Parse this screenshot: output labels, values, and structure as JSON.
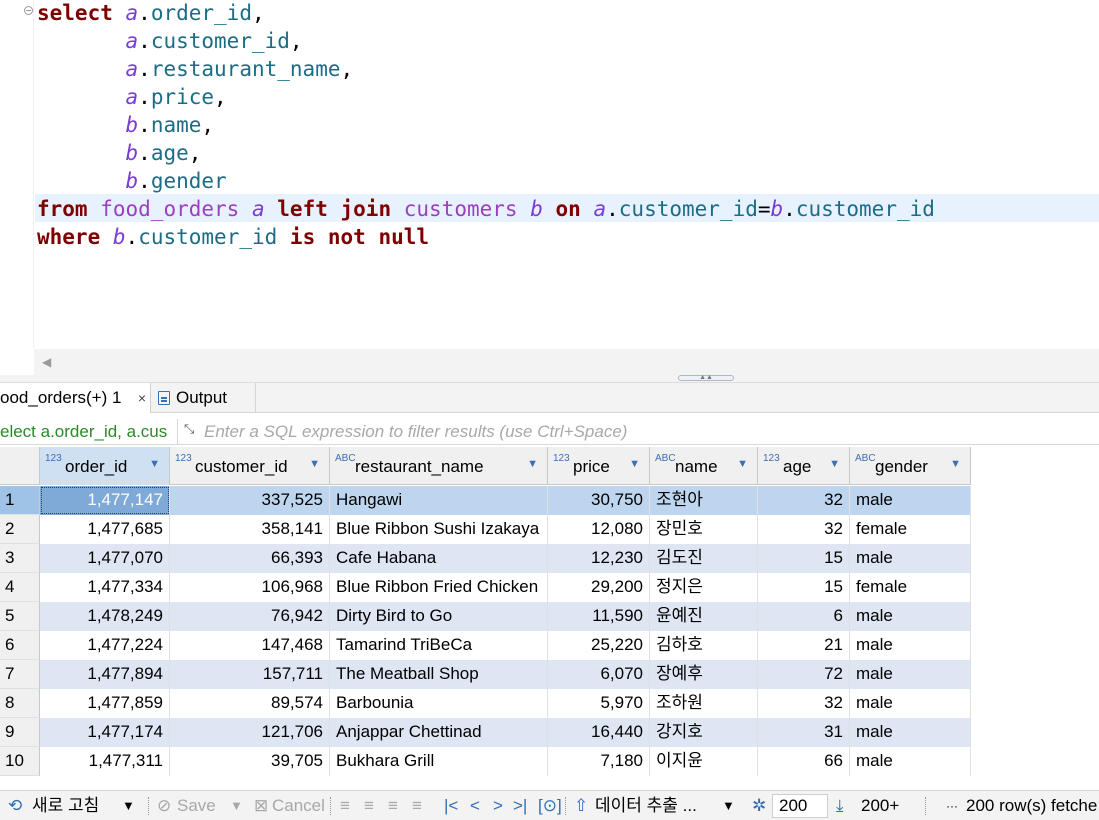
{
  "editor": {
    "lines": [
      [
        {
          "t": "select",
          "c": "kw"
        },
        {
          "t": " "
        },
        {
          "t": "a",
          "c": "al"
        },
        {
          "t": "."
        },
        {
          "t": "order_id",
          "c": "col"
        },
        {
          "t": ","
        }
      ],
      [
        {
          "t": "       "
        },
        {
          "t": "a",
          "c": "al"
        },
        {
          "t": "."
        },
        {
          "t": "customer_id",
          "c": "col"
        },
        {
          "t": ","
        }
      ],
      [
        {
          "t": "       "
        },
        {
          "t": "a",
          "c": "al"
        },
        {
          "t": "."
        },
        {
          "t": "restaurant_name",
          "c": "col"
        },
        {
          "t": ","
        }
      ],
      [
        {
          "t": "       "
        },
        {
          "t": "a",
          "c": "al"
        },
        {
          "t": "."
        },
        {
          "t": "price",
          "c": "col"
        },
        {
          "t": ","
        }
      ],
      [
        {
          "t": "       "
        },
        {
          "t": "b",
          "c": "al"
        },
        {
          "t": "."
        },
        {
          "t": "name",
          "c": "col"
        },
        {
          "t": ","
        }
      ],
      [
        {
          "t": "       "
        },
        {
          "t": "b",
          "c": "al"
        },
        {
          "t": "."
        },
        {
          "t": "age",
          "c": "col"
        },
        {
          "t": ","
        }
      ],
      [
        {
          "t": "       "
        },
        {
          "t": "b",
          "c": "al"
        },
        {
          "t": "."
        },
        {
          "t": "gender",
          "c": "col"
        }
      ],
      [
        {
          "t": "from",
          "c": "kw"
        },
        {
          "t": " "
        },
        {
          "t": "food_orders",
          "c": "tbl"
        },
        {
          "t": " "
        },
        {
          "t": "a",
          "c": "al"
        },
        {
          "t": " "
        },
        {
          "t": "left",
          "c": "kw"
        },
        {
          "t": " "
        },
        {
          "t": "join",
          "c": "kw"
        },
        {
          "t": " "
        },
        {
          "t": "customers",
          "c": "tbl"
        },
        {
          "t": " "
        },
        {
          "t": "b",
          "c": "al"
        },
        {
          "t": " "
        },
        {
          "t": "on",
          "c": "kw"
        },
        {
          "t": " "
        },
        {
          "t": "a",
          "c": "al"
        },
        {
          "t": "."
        },
        {
          "t": "customer_id",
          "c": "col"
        },
        {
          "t": "="
        },
        {
          "t": "b",
          "c": "al"
        },
        {
          "t": "."
        },
        {
          "t": "customer_id",
          "c": "col"
        }
      ],
      [
        {
          "t": "where",
          "c": "kw"
        },
        {
          "t": " "
        },
        {
          "t": "b",
          "c": "al"
        },
        {
          "t": "."
        },
        {
          "t": "customer_id",
          "c": "col"
        },
        {
          "t": " "
        },
        {
          "t": "is",
          "c": "kw"
        },
        {
          "t": " "
        },
        {
          "t": "not",
          "c": "kw"
        },
        {
          "t": " "
        },
        {
          "t": "null",
          "c": "kw"
        }
      ]
    ]
  },
  "tabs": {
    "results_label": "ood_orders(+) 1",
    "close_glyph": "×",
    "output_label": "Output"
  },
  "filter": {
    "query_text": "elect a.order_id, a.cus",
    "placeholder": "Enter a SQL expression to filter results (use Ctrl+Space)"
  },
  "grid": {
    "columns": [
      {
        "name": "order_id",
        "type": "123"
      },
      {
        "name": "customer_id",
        "type": "123"
      },
      {
        "name": "restaurant_name",
        "type": "ABC"
      },
      {
        "name": "price",
        "type": "123"
      },
      {
        "name": "name",
        "type": "ABC"
      },
      {
        "name": "age",
        "type": "123"
      },
      {
        "name": "gender",
        "type": "ABC"
      }
    ],
    "rows": [
      {
        "n": "1",
        "cells": [
          "1,477,147",
          "337,525",
          "Hangawi",
          "30,750",
          "조현아",
          "32",
          "male"
        ]
      },
      {
        "n": "2",
        "cells": [
          "1,477,685",
          "358,141",
          "Blue Ribbon Sushi Izakaya",
          "12,080",
          "장민호",
          "32",
          "female"
        ]
      },
      {
        "n": "3",
        "cells": [
          "1,477,070",
          "66,393",
          "Cafe Habana",
          "12,230",
          "김도진",
          "15",
          "male"
        ]
      },
      {
        "n": "4",
        "cells": [
          "1,477,334",
          "106,968",
          "Blue Ribbon Fried Chicken",
          "29,200",
          "정지은",
          "15",
          "female"
        ]
      },
      {
        "n": "5",
        "cells": [
          "1,478,249",
          "76,942",
          "Dirty Bird to Go",
          "11,590",
          "윤예진",
          "6",
          "male"
        ]
      },
      {
        "n": "6",
        "cells": [
          "1,477,224",
          "147,468",
          "Tamarind TriBeCa",
          "25,220",
          "김하호",
          "21",
          "male"
        ]
      },
      {
        "n": "7",
        "cells": [
          "1,477,894",
          "157,711",
          "The Meatball Shop",
          "6,070",
          "장예후",
          "72",
          "male"
        ]
      },
      {
        "n": "8",
        "cells": [
          "1,477,859",
          "89,574",
          "Barbounia",
          "5,970",
          "조하원",
          "32",
          "male"
        ]
      },
      {
        "n": "9",
        "cells": [
          "1,477,174",
          "121,706",
          "Anjappar Chettinad",
          "16,440",
          "강지호",
          "31",
          "male"
        ]
      },
      {
        "n": "10",
        "cells": [
          "1,477,311",
          "39,705",
          "Bukhara Grill",
          "7,180",
          "이지윤",
          "66",
          "male"
        ]
      }
    ]
  },
  "toolbar": {
    "refresh_label": "새로 고침",
    "save_label": "Save",
    "cancel_label": "Cancel",
    "export_label": "데이터 추출 ...",
    "fetch_size": "200",
    "fetch_next_label": "200+",
    "status": "200 row(s) fetche"
  }
}
